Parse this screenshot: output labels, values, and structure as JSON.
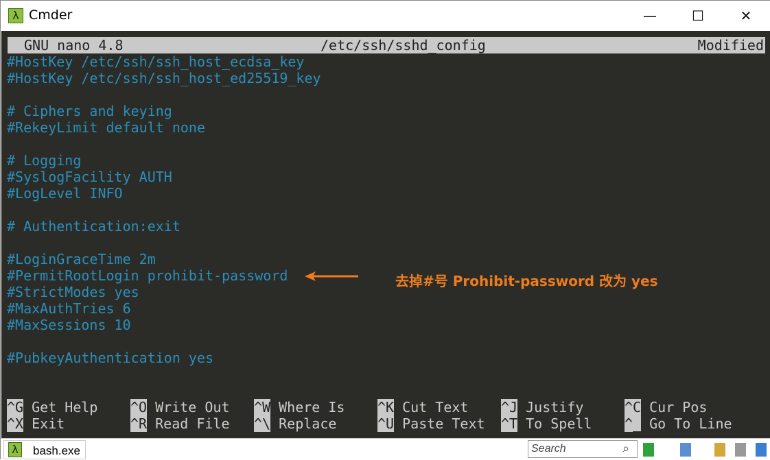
{
  "window": {
    "title": "Cmder",
    "icon": "lambda-icon",
    "controls": [
      "minimize",
      "maximize",
      "close"
    ]
  },
  "nano": {
    "version": "GNU nano 4.8",
    "file": "/etc/ssh/sshd_config",
    "status": "Modified"
  },
  "lines": [
    "#HostKey /etc/ssh/ssh_host_ecdsa_key",
    "#HostKey /etc/ssh/ssh_host_ed25519_key",
    "",
    "# Ciphers and keying",
    "#RekeyLimit default none",
    "",
    "# Logging",
    "#SyslogFacility AUTH",
    "#LogLevel INFO",
    "",
    "# Authentication:exit",
    "",
    "#LoginGraceTime 2m",
    "#PermitRootLogin prohibit-password",
    "#StrictModes yes",
    "#MaxAuthTries 6",
    "#MaxSessions 10",
    "",
    "#PubkeyAuthentication yes"
  ],
  "shortcuts": [
    [
      {
        "key": "^G",
        "label": "Get Help"
      },
      {
        "key": "^O",
        "label": "Write Out"
      },
      {
        "key": "^W",
        "label": "Where Is"
      },
      {
        "key": "^K",
        "label": "Cut Text"
      },
      {
        "key": "^J",
        "label": "Justify"
      },
      {
        "key": "^C",
        "label": "Cur Pos"
      }
    ],
    [
      {
        "key": "^X",
        "label": "Exit"
      },
      {
        "key": "^R",
        "label": "Read File"
      },
      {
        "key": "^\\",
        "label": "Replace"
      },
      {
        "key": "^U",
        "label": "Paste Text"
      },
      {
        "key": "^T",
        "label": "To Spell"
      },
      {
        "key": "^_",
        "label": "Go To Line"
      }
    ]
  ],
  "annotation": {
    "text": "去掉#号  Prohibit-password 改为 yes",
    "color": "#f07c1e"
  },
  "statusbar": {
    "tab": "bash.exe",
    "search_placeholder": "Search"
  }
}
